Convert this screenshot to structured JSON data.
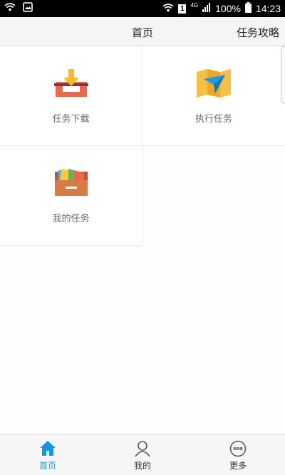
{
  "statusbar": {
    "network": "4G",
    "sim_slot": "1",
    "battery": "100%",
    "time": "14:23",
    "icons": [
      "wifi-calling-icon",
      "image-notification-icon",
      "wifi-icon",
      "sim-icon",
      "signal-icon",
      "battery-icon"
    ]
  },
  "header": {
    "title": "首页",
    "action": "任务攻略"
  },
  "grid": [
    {
      "label": "任务下载",
      "icon": "download-tray-icon"
    },
    {
      "label": "执行任务",
      "icon": "map-navigation-icon"
    },
    {
      "label": "我的任务",
      "icon": "folder-drawer-icon"
    }
  ],
  "bottom_nav": [
    {
      "label": "首页",
      "icon": "home-icon",
      "active": true
    },
    {
      "label": "我的",
      "icon": "person-icon",
      "active": false
    },
    {
      "label": "更多",
      "icon": "more-icon",
      "active": false
    }
  ],
  "colors": {
    "accent": "#1596e0",
    "header_bg": "#f5f5f7",
    "statusbar_bg": "#000000"
  }
}
